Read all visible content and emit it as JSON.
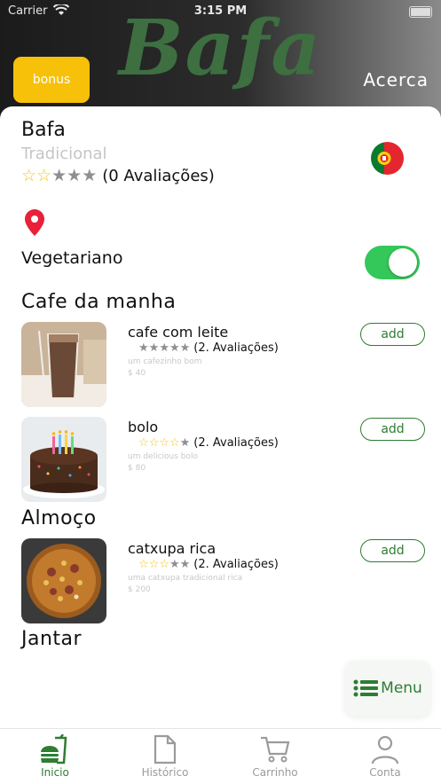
{
  "status_bar": {
    "carrier": "Carrier",
    "time": "3:15 PM"
  },
  "header": {
    "brand": "Bafa",
    "bonus_label": "bonus",
    "about_label": "Acerca"
  },
  "restaurant": {
    "name": "Bafa",
    "type": "Tradicional",
    "rating_value": 2,
    "rating_text": "(0 Avaliações)",
    "flag": "portugal-flag-icon"
  },
  "filters": {
    "vegetarian_label": "Vegetariano",
    "vegetarian_on": true
  },
  "sections": [
    {
      "title": "Cafe da manha",
      "items": [
        {
          "name": "cafe com leite",
          "stars": 0,
          "reviews": "(2. Avaliações)",
          "description": "um cafezinho bom",
          "price": "$ 40",
          "add_label": "add"
        },
        {
          "name": "bolo",
          "stars": 4,
          "reviews": "(2. Avaliações)",
          "description": "um delicious bolo",
          "price": "$ 80",
          "add_label": "add"
        }
      ]
    },
    {
      "title": "Almoço",
      "items": [
        {
          "name": "catxupa rica",
          "stars": 3,
          "reviews": "(2. Avaliações)",
          "description": "uma catxupa tradicional rica",
          "price": "$ 200",
          "add_label": "add"
        }
      ]
    },
    {
      "title": "Jantar",
      "items": []
    }
  ],
  "menu_button": {
    "label": "Menu",
    "icon": "list-icon"
  },
  "tabbar": [
    {
      "label": "Inicio",
      "icon": "burger-drink-icon",
      "active": true
    },
    {
      "label": "Histórico",
      "icon": "document-icon",
      "active": false
    },
    {
      "label": "Carrinho",
      "icon": "cart-icon",
      "active": false
    },
    {
      "label": "Conta",
      "icon": "person-icon",
      "active": false
    }
  ],
  "colors": {
    "accent": "#2e7d32",
    "bonus": "#f7c10a",
    "toggle": "#34c759",
    "star": "#f5c518",
    "pin": "#e8203a"
  }
}
